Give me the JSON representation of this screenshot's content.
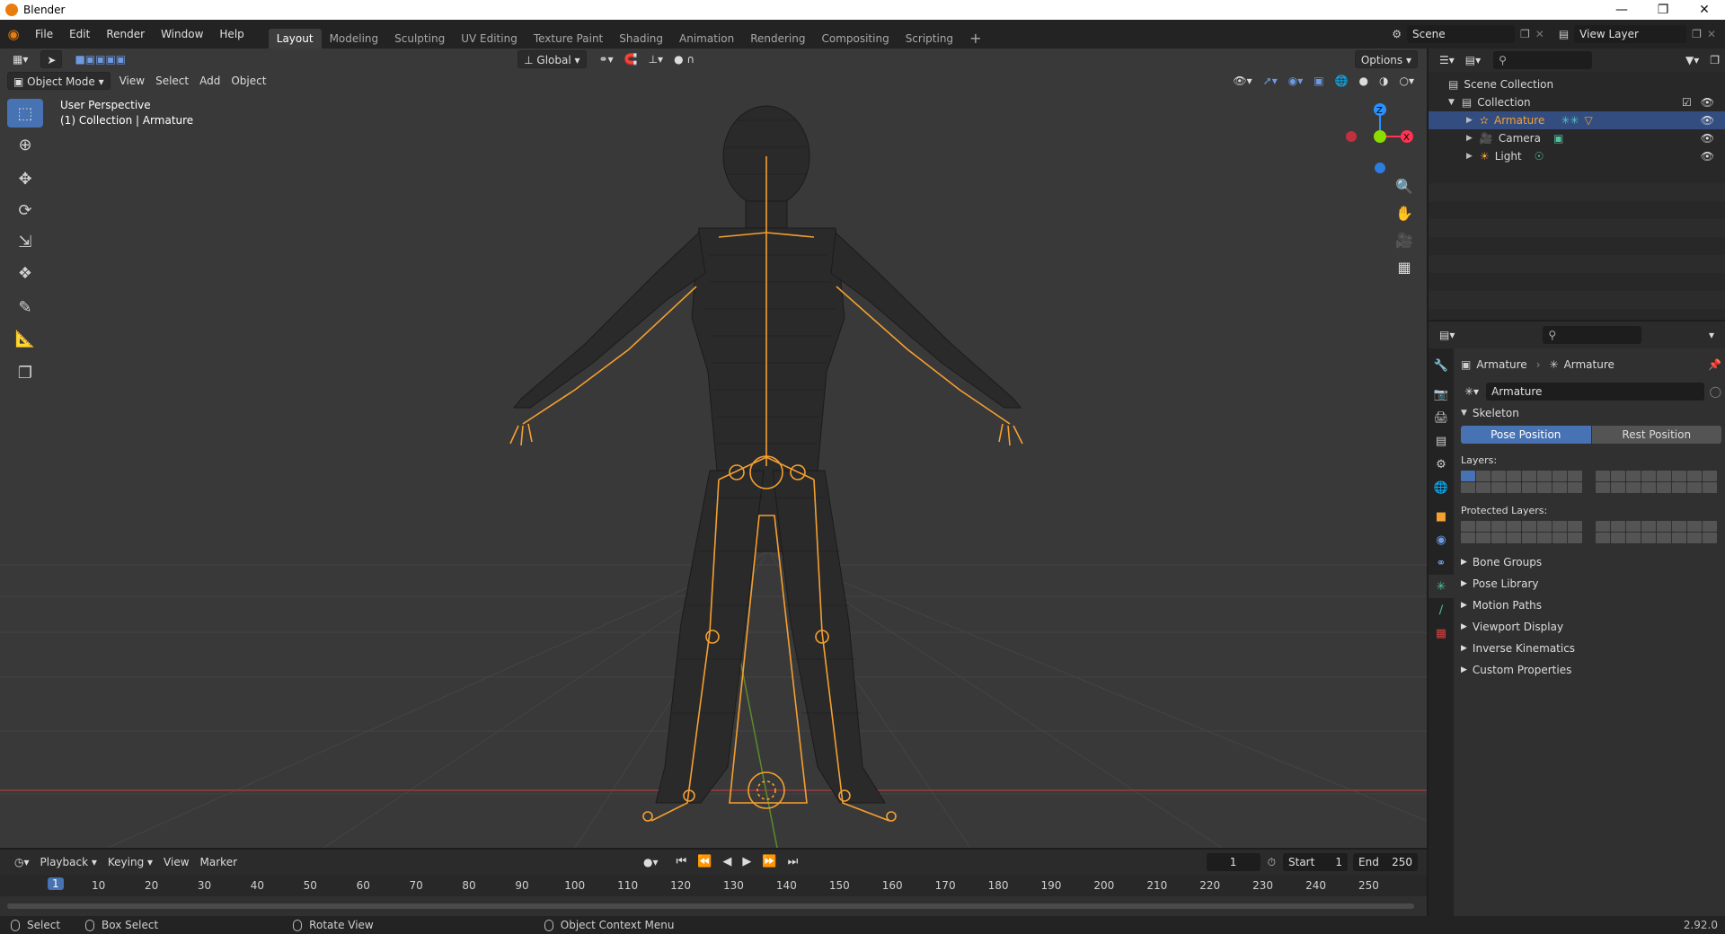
{
  "window": {
    "title": "Blender"
  },
  "menubar": {
    "menus": [
      "File",
      "Edit",
      "Render",
      "Window",
      "Help"
    ],
    "workspaces": [
      "Layout",
      "Modeling",
      "Sculpting",
      "UV Editing",
      "Texture Paint",
      "Shading",
      "Animation",
      "Rendering",
      "Compositing",
      "Scripting"
    ],
    "active_workspace": "Layout",
    "scene": "Scene",
    "view_layer": "View Layer"
  },
  "viewport": {
    "transform_orientation": "Global",
    "options_label": "Options",
    "mode": "Object Mode",
    "menus": [
      "View",
      "Select",
      "Add",
      "Object"
    ],
    "overlay_title": "User Perspective",
    "overlay_subtitle": "(1) Collection | Armature",
    "gizmo_axes": {
      "z": "Z",
      "x": "X"
    },
    "tools": [
      "select-box-icon",
      "cursor-icon",
      "move-icon",
      "rotate-icon",
      "scale-icon",
      "transform-icon",
      "annotate-icon",
      "measure-icon",
      "add-cube-icon"
    ]
  },
  "timeline": {
    "menus": [
      "Playback",
      "Keying",
      "View",
      "Marker"
    ],
    "current_frame": "1",
    "start_label": "Start",
    "start_value": "1",
    "end_label": "End",
    "end_value": "250",
    "ruler": [
      "1",
      "10",
      "20",
      "30",
      "40",
      "50",
      "60",
      "70",
      "80",
      "90",
      "100",
      "110",
      "120",
      "130",
      "140",
      "150",
      "160",
      "170",
      "180",
      "190",
      "200",
      "210",
      "220",
      "230",
      "240",
      "250"
    ]
  },
  "outliner": {
    "root": "Scene Collection",
    "collection": "Collection",
    "items": [
      {
        "name": "Armature",
        "selected": true
      },
      {
        "name": "Camera",
        "selected": false
      },
      {
        "name": "Light",
        "selected": false
      }
    ]
  },
  "properties": {
    "breadcrumb_object": "Armature",
    "breadcrumb_data": "Armature",
    "datablock_name": "Armature",
    "skeleton_label": "Skeleton",
    "pose_position": "Pose Position",
    "rest_position": "Rest Position",
    "layers_label": "Layers:",
    "protected_layers_label": "Protected Layers:",
    "panels": [
      "Bone Groups",
      "Pose Library",
      "Motion Paths",
      "Viewport Display",
      "Inverse Kinematics",
      "Custom Properties"
    ]
  },
  "statusbar": {
    "select": "Select",
    "box_select": "Box Select",
    "rotate_view": "Rotate View",
    "context_menu": "Object Context Menu",
    "version": "2.92.0"
  },
  "colors": {
    "accent": "#4772b3",
    "selection_orange": "#f5a030",
    "axis_x": "#ff3352",
    "axis_y": "#8bdc00",
    "axis_z": "#2890ff"
  }
}
